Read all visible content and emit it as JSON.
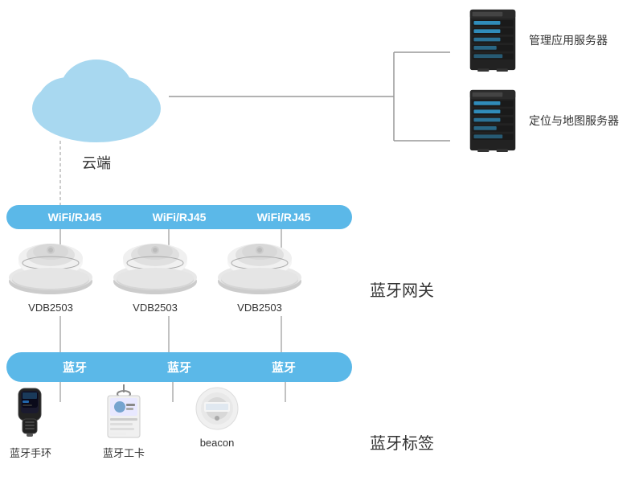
{
  "cloud": {
    "label": "云端"
  },
  "servers": [
    {
      "label": "管理应用服务器",
      "id": "mgmt-server"
    },
    {
      "label": "定位与地图服务器",
      "id": "location-server"
    }
  ],
  "wifi_pills": [
    {
      "label": "WiFi/RJ45"
    },
    {
      "label": "WiFi/RJ45"
    },
    {
      "label": "WiFi/RJ45"
    }
  ],
  "gateways": [
    {
      "label": "VDB2503"
    },
    {
      "label": "VDB2503"
    },
    {
      "label": "VDB2503"
    }
  ],
  "gateway_title": "蓝牙网关",
  "bt_pills": [
    {
      "label": "蓝牙"
    },
    {
      "label": "蓝牙"
    },
    {
      "label": "蓝牙"
    }
  ],
  "tags": [
    {
      "label": "蓝牙手环",
      "type": "bracelet"
    },
    {
      "label": "蓝牙工卡",
      "type": "card"
    },
    {
      "label": "beacon",
      "type": "beacon"
    }
  ],
  "tag_title": "蓝牙标签",
  "colors": {
    "blue_pill": "#5bb8e8",
    "cloud": "#a8d8f0",
    "server_dark": "#2a2a2a",
    "server_blue": "#4488bb"
  }
}
